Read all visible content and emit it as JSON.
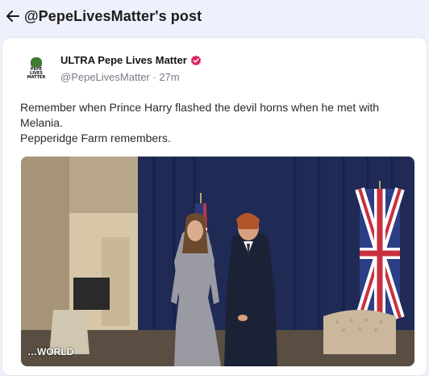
{
  "header": {
    "title": "@PepeLivesMatter's post"
  },
  "post": {
    "avatar_text": [
      "PEPE",
      "LIVES",
      "MATTER"
    ],
    "display_name": "ULTRA Pepe Lives Matter",
    "handle": "@PepeLivesMatter",
    "separator": " · ",
    "time": "27m",
    "text_lines": [
      "Remember when Prince Harry flashed the devil horns when he met with Melania.",
      "Pepperidge Farm remembers."
    ],
    "media_watermark": "…WORLD"
  },
  "colors": {
    "badge": "#e0245e",
    "background": "#eef0fb",
    "card": "#ffffff"
  },
  "icons": {
    "back": "arrow-left-icon",
    "verified": "verified-badge-icon"
  }
}
